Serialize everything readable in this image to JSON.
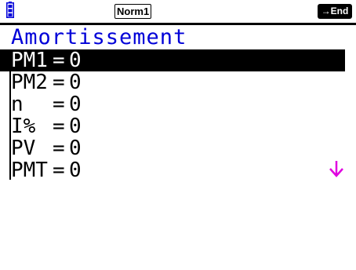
{
  "status": {
    "battery_icon": "battery-icon",
    "mode": "Norm1",
    "end_label": "→End"
  },
  "title": "Amortissement",
  "rows": [
    {
      "name": "PM1",
      "value": "0"
    },
    {
      "name": "PM2",
      "value": "0"
    },
    {
      "name": "n",
      "value": "0"
    },
    {
      "name": "I%",
      "value": "0"
    },
    {
      "name": "PV",
      "value": "0"
    },
    {
      "name": "PMT",
      "value": "0"
    }
  ],
  "equals": "=",
  "selected_index": 0,
  "colors": {
    "title": "#0000d8",
    "highlight": "#000000",
    "scroll_arrow": "#e000e0"
  },
  "scroll_icon": "down-arrow-icon"
}
